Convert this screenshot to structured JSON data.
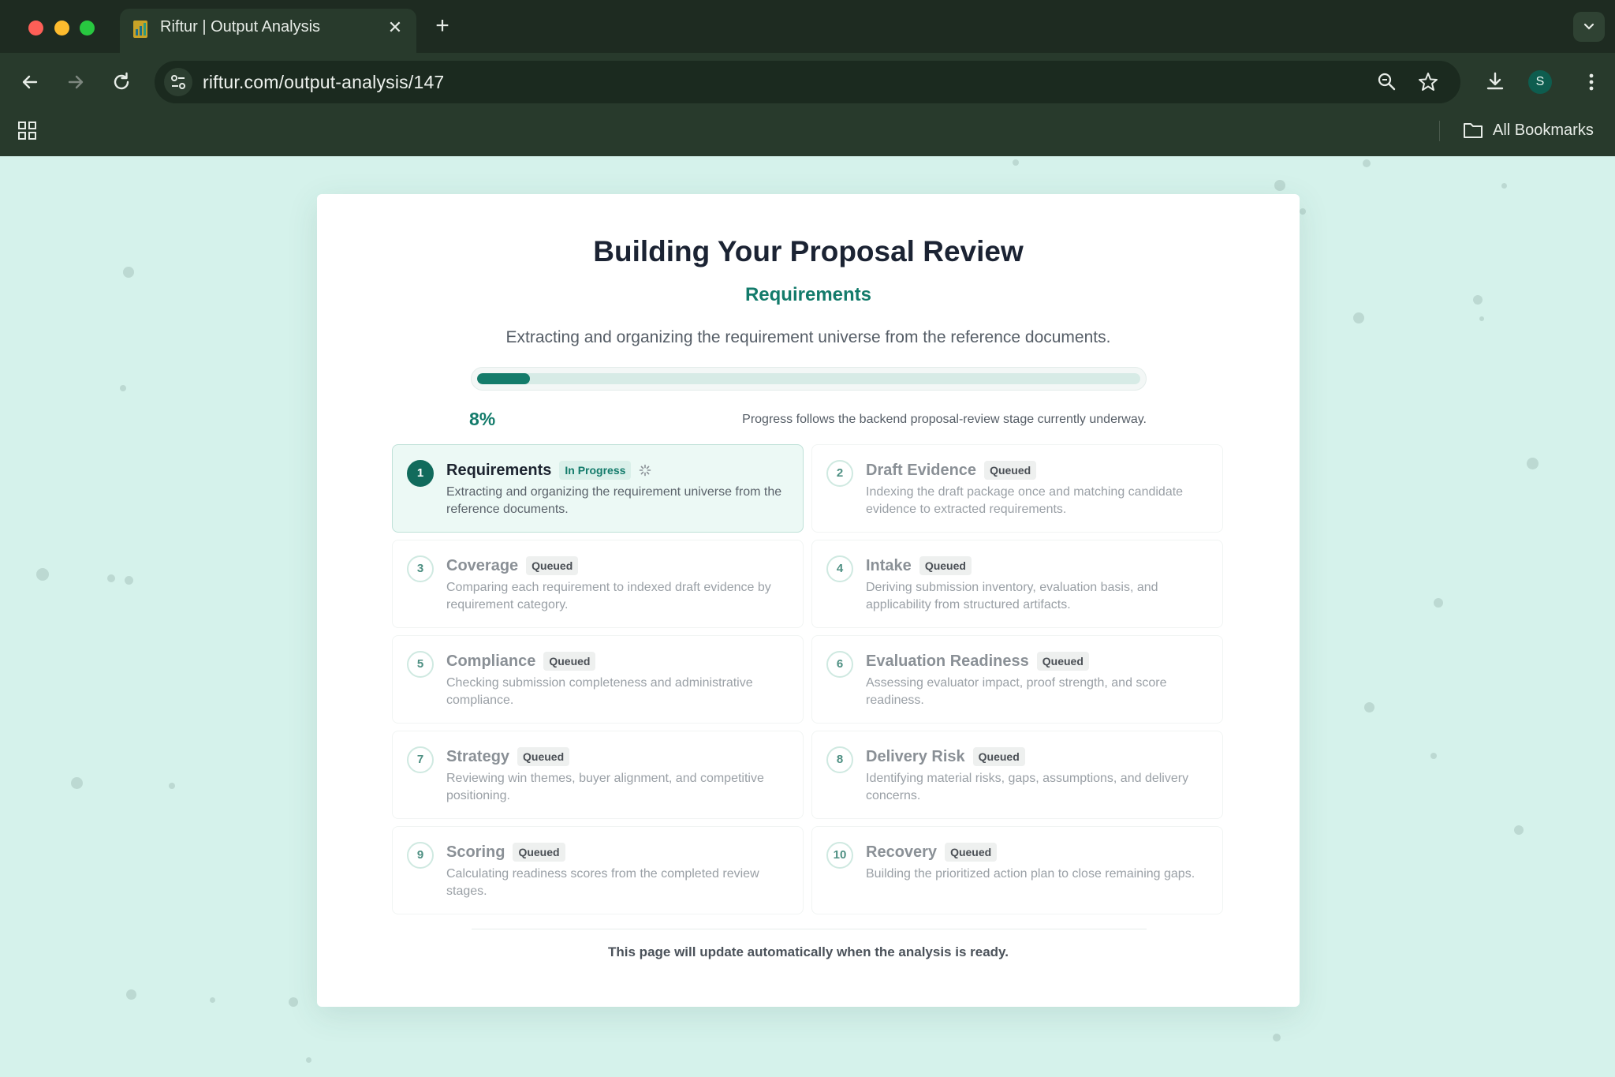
{
  "browser": {
    "tab_title": "Riftur | Output Analysis",
    "url": "riftur.com/output-analysis/147",
    "profile_initial": "S",
    "bookmarks_label": "All Bookmarks"
  },
  "review": {
    "title": "Building Your Proposal Review",
    "current_stage": "Requirements",
    "description": "Extracting and organizing the requirement universe from the reference documents.",
    "progress_percent": 8,
    "progress_label": "8%",
    "progress_note": "Progress follows the backend proposal-review stage currently underway.",
    "footer_note": "This page will update automatically when the analysis is ready."
  },
  "stages": [
    {
      "num": "1",
      "title": "Requirements",
      "status": "In Progress",
      "desc": "Extracting and organizing the requirement universe from the reference documents."
    },
    {
      "num": "2",
      "title": "Draft Evidence",
      "status": "Queued",
      "desc": "Indexing the draft package once and matching candidate evidence to extracted requirements."
    },
    {
      "num": "3",
      "title": "Coverage",
      "status": "Queued",
      "desc": "Comparing each requirement to indexed draft evidence by requirement category."
    },
    {
      "num": "4",
      "title": "Intake",
      "status": "Queued",
      "desc": "Deriving submission inventory, evaluation basis, and applicability from structured artifacts."
    },
    {
      "num": "5",
      "title": "Compliance",
      "status": "Queued",
      "desc": "Checking submission completeness and administrative compliance."
    },
    {
      "num": "6",
      "title": "Evaluation Readiness",
      "status": "Queued",
      "desc": "Assessing evaluator impact, proof strength, and score readiness."
    },
    {
      "num": "7",
      "title": "Strategy",
      "status": "Queued",
      "desc": "Reviewing win themes, buyer alignment, and competitive positioning."
    },
    {
      "num": "8",
      "title": "Delivery Risk",
      "status": "Queued",
      "desc": "Identifying material risks, gaps, assumptions, and delivery concerns."
    },
    {
      "num": "9",
      "title": "Scoring",
      "status": "Queued",
      "desc": "Calculating readiness scores from the completed review stages."
    },
    {
      "num": "10",
      "title": "Recovery",
      "status": "Queued",
      "desc": "Building the prioritized action plan to close remaining gaps."
    }
  ],
  "colors": {
    "accent": "#137b6b",
    "page_bg": "#d5f2eb",
    "chrome_bg": "#283a2c"
  }
}
